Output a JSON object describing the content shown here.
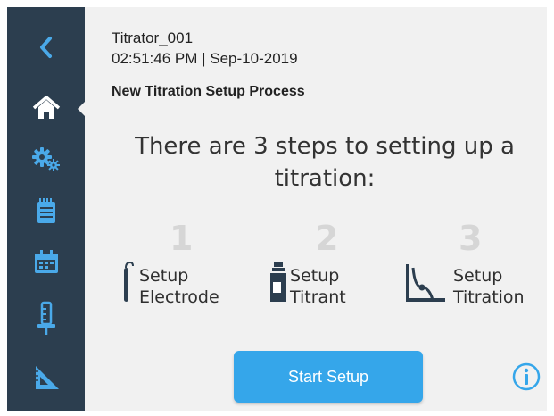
{
  "device": {
    "name": "Titrator_001",
    "datetime": "02:51:46 PM | Sep-10-2019"
  },
  "page": {
    "title": "New Titration Setup Process",
    "headline": "There are 3 steps to setting up a titration:"
  },
  "sidebar": {
    "items": [
      {
        "icon": "back-chevron-icon"
      },
      {
        "icon": "home-icon",
        "active": true
      },
      {
        "icon": "settings-gears-icon"
      },
      {
        "icon": "notepad-icon"
      },
      {
        "icon": "calendar-icon"
      },
      {
        "icon": "burette-icon"
      },
      {
        "icon": "ruler-triangle-icon"
      }
    ]
  },
  "steps": [
    {
      "number": "1",
      "label_line1": "Setup",
      "label_line2": "Electrode",
      "icon": "electrode-icon"
    },
    {
      "number": "2",
      "label_line1": "Setup",
      "label_line2": "Titrant",
      "icon": "bottle-icon"
    },
    {
      "number": "3",
      "label_line1": "Setup",
      "label_line2": "Titration",
      "icon": "titration-curve-icon"
    }
  ],
  "actions": {
    "start_label": "Start Setup",
    "info_icon": "info-icon"
  },
  "colors": {
    "sidebar": "#2c3e4f",
    "accent": "#35a6ea",
    "icon_light": "#ffffff",
    "icon_blue": "#4aa9e9",
    "step_number": "#d6d6d6",
    "background": "#f1f1f1"
  }
}
